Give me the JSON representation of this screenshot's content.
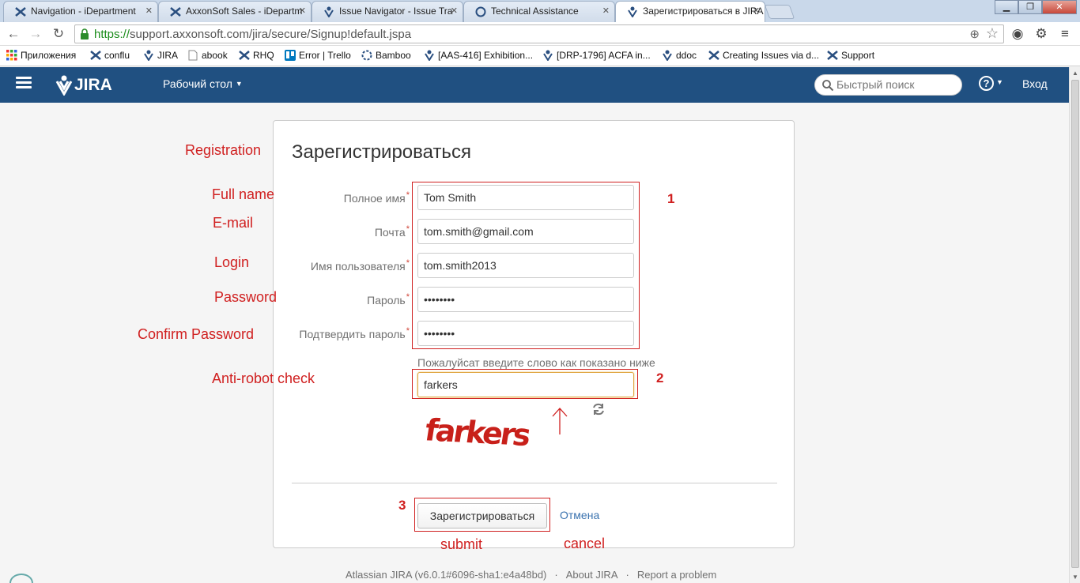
{
  "browser": {
    "tabs": [
      {
        "label": "Navigation - iDepartment",
        "active": false
      },
      {
        "label": "AxxonSoft Sales - iDepartm",
        "active": false
      },
      {
        "label": "Issue Navigator - Issue Tra",
        "active": false
      },
      {
        "label": "Technical Assistance",
        "active": false
      },
      {
        "label": "Зарегистрироваться в JIRA",
        "active": true
      }
    ],
    "url_scheme": "https://",
    "url_rest": "support.axxonsoft.com/jira/secure/Signup!default.jspa",
    "bookmarks": [
      "Приложения",
      "conflu",
      "JIRA",
      "abook",
      "RHQ",
      "Error | Trello",
      "Bamboo",
      "[AAS-416] Exhibition...",
      "[DRP-1796] ACFA in...",
      "ddoc",
      "Creating Issues via d...",
      "Support"
    ]
  },
  "header": {
    "logo_text": "JIRA",
    "dashboard_label": "Рабочий стол",
    "search_placeholder": "Быстрый поиск",
    "login_label": "Вход"
  },
  "form": {
    "title": "Зарегистрироваться",
    "fields": [
      {
        "label": "Полное имя",
        "value": "Tom Smith",
        "type": "text"
      },
      {
        "label": "Почта",
        "value": "tom.smith@gmail.com",
        "type": "text"
      },
      {
        "label": "Имя пользователя",
        "value": "tom.smith2013",
        "type": "text"
      },
      {
        "label": "Пароль",
        "value": "password",
        "type": "password"
      },
      {
        "label": "Подтвердить пароль",
        "value": "password",
        "type": "password"
      }
    ],
    "required_mark": "*",
    "captcha_hint": "Пожалуйсат введите слово как показано ниже",
    "captcha_value": "farkers",
    "captcha_word": "farkers",
    "submit_label": "Зарегистрироваться",
    "cancel_label": "Отмена"
  },
  "annotations": {
    "registration": "Registration",
    "full_name": "Full name",
    "email": "E-mail",
    "login": "Login",
    "password": "Password",
    "confirm_password": "Confirm Password",
    "anti_robot": "Anti-robot check",
    "submit": "submit",
    "cancel": "cancel",
    "num1": "1",
    "num2": "2",
    "num3": "3"
  },
  "footer": {
    "version": "Atlassian JIRA (v6.0.1#6096-sha1:e4a48bd)",
    "about": "About JIRA",
    "report": "Report a problem"
  },
  "colors": {
    "header_bg": "#205081",
    "annotation_red": "#d02020",
    "link_blue": "#3b73af",
    "captcha_red": "#c8201a"
  }
}
